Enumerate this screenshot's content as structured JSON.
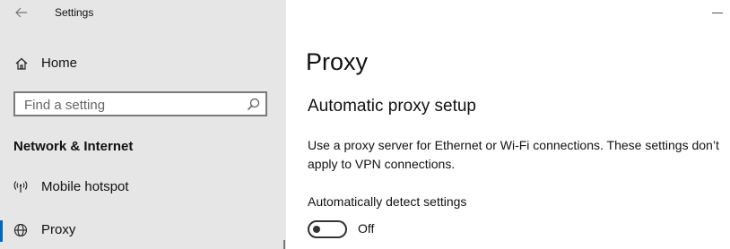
{
  "window": {
    "title": "Settings"
  },
  "sidebar": {
    "home_label": "Home",
    "search_placeholder": "Find a setting",
    "section_heading": "Network & Internet",
    "items": [
      {
        "label": "Mobile hotspot",
        "icon": "hotspot-icon",
        "selected": false
      },
      {
        "label": "Proxy",
        "icon": "globe-icon",
        "selected": true
      }
    ]
  },
  "main": {
    "page_title": "Proxy",
    "section_title": "Automatic proxy setup",
    "description": "Use a proxy server for Ethernet or Wi-Fi connections. These settings don’t apply to VPN connections.",
    "auto_detect": {
      "label": "Automatically detect settings",
      "state": "Off",
      "on": false
    }
  },
  "colors": {
    "accent": "#0067b8",
    "sidebar_bg": "#e6e6e6"
  }
}
